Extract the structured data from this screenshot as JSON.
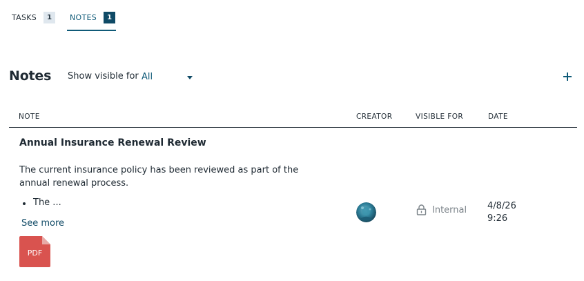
{
  "tabs": [
    {
      "label": "TASKS",
      "count": "1"
    },
    {
      "label": "NOTES",
      "count": "1"
    }
  ],
  "section": {
    "title": "Notes",
    "filter_label": "Show visible for",
    "filter_value": "All"
  },
  "table": {
    "columns": [
      "NOTE",
      "CREATOR",
      "VISIBLE FOR",
      "DATE"
    ],
    "rows": [
      {
        "title": "Annual Insurance Renewal Review",
        "body": "The current insurance policy has been reviewed as part of the annual renewal process.",
        "bullet": "The ...",
        "see_more": "See more",
        "attachment_label": "PDF",
        "visible_for": "Internal",
        "date_line1": "4/8/26",
        "date_line2": "9:26"
      }
    ]
  },
  "icons": {
    "add": "plus-icon",
    "dropdown": "chevron-down-icon",
    "visibility": "lock-icon",
    "attachment": "pdf-file-icon"
  },
  "colors": {
    "accent": "#0f5a78",
    "badge_dark": "#0f4a66",
    "pdf": "#d9534f"
  }
}
